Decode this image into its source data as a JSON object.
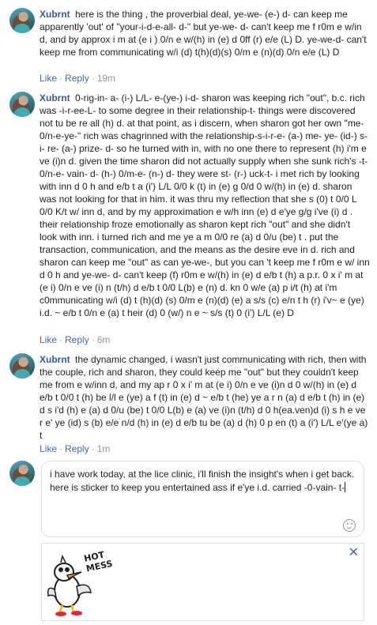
{
  "comments": [
    {
      "author": "Xubrnt",
      "text": "here is the thing , the proverbial deal, ye-we- (e-) d- can keep me apparently 'out' of \"your-i-d-e-all- d-\" but ye-we- d- can't keep me f r0m e w/in d, and by approx i m at (e i ) 0/n e w/(h) in (e) d 0ff (r) e/e (L) D. ye-we-d- can't keep me from communicating w/i (d) t(h)(d)(s) 0/m e (n)(d) 0/n e/e (L) D",
      "like": "Like",
      "reply": "Reply",
      "time": "19m"
    },
    {
      "author": "Xubrnt",
      "text": "0-rig-in- a- (i-) L/L- e-(ye-) i-d- sharon was keeping rich \"out\", b.c. rich was -i-r-ee-L- to some degree in their relationship-t- things were discovered not tu be re all (h) d. at that point, as i discern, when sharon got her own \"me-0/n-e-ye-\" rich was chagrinned with the relationship-s-i-r-e- (a-) me- ye- (id-) s- i- re- (a-) prize- d- so he turned with in, with no one there to represent (h) i'm e ve (i)n d. given the time sharon did not actually supply when she sunk rich's -t- 0/n-e- vain- d- (h-) 0/m-e- (n-) d- they were st- (r-) uck-t- i met rich by looking with inn d 0 h and e/b t a (i') L/L 0/0 k (t) in (e) g 0/d 0 w/(h) in (e) d. sharon was not looking for that in him. it was thru my reflection that she s (0) t 0/0 L 0/0 K/t w/ inn d, and by my approximation e w/h inn (e) d e'ye g/g i've (i) d . their relationship froze emotionally as sharon kept rich \"out\" and she didn't look with inn. i turned rich and me ye a m 0/0 re (a) d 0/u (be) t . put the transaction, communication, and the means as the desire eve in d. rich and sharon can keep me \"out\" as can ye-we-, but you can 't keep me f r0m e w/ inn d 0 h and ye-we- d- can't keep (f) r0m e w/(h) in (e) d e/b t (h) a p.r. 0 x i' m at (e i) 0/n e ve (i) n (t/h) d e/b t 0/0 L(b) e (n) d. kn 0 w/e (a) p i/t (h) at i'm c0mmunicating w/i (d) t (h)(d) (s) 0/m e (n)(d) (e) a s/s (c) e/n t h (r) i'v~ e (ye) i.d. ~ e/b t 0/n e (a) t heir (d) 0 (w/) n e ~ s/s (t) 0 (i') L/L (e) D",
      "like": "Like",
      "reply": "Reply",
      "time": "6m"
    },
    {
      "author": "Xubrnt",
      "text": "the dynamic changed, i wasn't just communicating with rich, then with the couple, rich and sharon, they could keep me \"out\" but they couldn't keep me from e w/inn d, and my ap r 0 x i' m at (e i) 0/n e ve (i)n d 0 w/(h) in (e) d e/b t 0/0 t (h) be l/l e (ye) a f (t) in (e) d ~ e/b t (he) ye a r n (a) d e/b t (h) in (e) d s i'd (h) e (a) d 0/u (be) t 0/0 L(b) e (a) ve (i)n (t/h) d 0 h(ea.ven)d (i) s h e ve r e' ye (id) s (b) e/e n/d (h) in (e) d e/b tu be (a) d (h) 0 p en (t) a (i') L/L e'(ye a) t",
      "like": "Like",
      "reply": "Reply",
      "time": "1m"
    }
  ],
  "composer": {
    "text": "i have work today, at the lice clinic, i'll finish the insight's when i get back. here is sticker to keep you entertained ass if e'ye i.d. carried -0-vain- t-"
  },
  "sticker": {
    "caption": "HOT MESS",
    "close_glyph": "✕"
  },
  "colors": {
    "author": "#365899",
    "meta": "#90949c",
    "border": "#dddfe2"
  }
}
